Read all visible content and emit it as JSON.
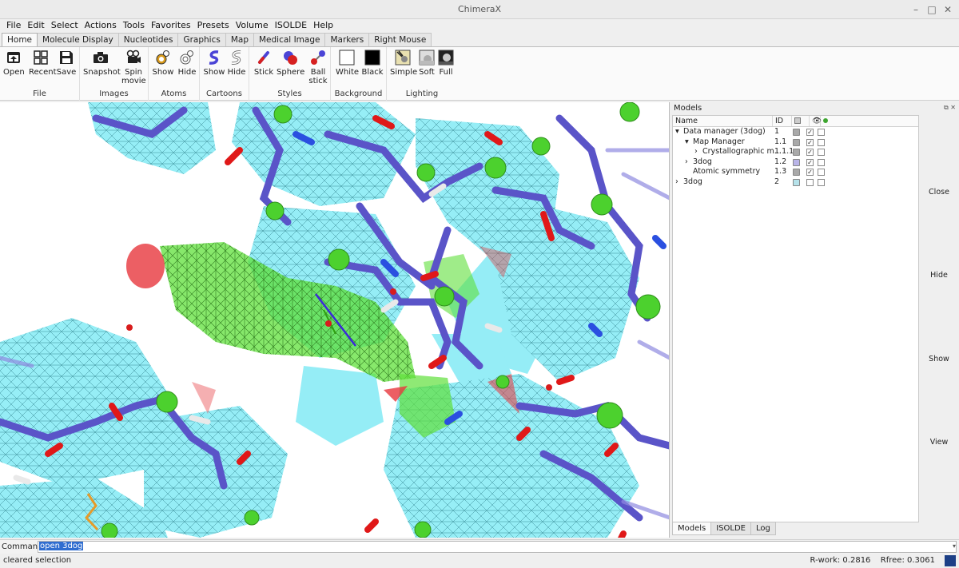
{
  "window": {
    "title": "ChimeraX"
  },
  "menu": [
    "File",
    "Edit",
    "Select",
    "Actions",
    "Tools",
    "Favorites",
    "Presets",
    "Volume",
    "ISOLDE",
    "Help"
  ],
  "ribbon_tabs": [
    "Home",
    "Molecule Display",
    "Nucleotides",
    "Graphics",
    "Map",
    "Medical Image",
    "Markers",
    "Right Mouse"
  ],
  "ribbon": {
    "file": {
      "label": "File",
      "open": "Open",
      "recent": "Recent",
      "save": "Save"
    },
    "images": {
      "label": "Images",
      "snapshot": "Snapshot",
      "spin1": "Spin",
      "spin2": "movie"
    },
    "atoms": {
      "label": "Atoms",
      "show": "Show",
      "hide": "Hide"
    },
    "cartoons": {
      "label": "Cartoons",
      "show": "Show",
      "hide": "Hide"
    },
    "styles": {
      "label": "Styles",
      "stick": "Stick",
      "sphere": "Sphere",
      "ball1": "Ball",
      "ball2": "stick"
    },
    "background": {
      "label": "Background",
      "white": "White",
      "black": "Black"
    },
    "lighting": {
      "label": "Lighting",
      "simple": "Simple",
      "soft": "Soft",
      "full": "Full"
    }
  },
  "models_panel": {
    "title": "Models",
    "headers": {
      "name": "Name",
      "id": "ID"
    },
    "rows": [
      {
        "name": "Data manager (3dog)",
        "id": "1",
        "color": "#a9a9a9",
        "shown": true,
        "indent": 0,
        "arrow": "▾"
      },
      {
        "name": "Map Manager",
        "id": "1.1",
        "color": "#a9a9a9",
        "shown": true,
        "indent": 1,
        "arrow": "▾"
      },
      {
        "name": "Crystallographic m...",
        "id": "1.1.1",
        "color": "#a9a9a9",
        "shown": true,
        "indent": 2,
        "arrow": "›"
      },
      {
        "name": "3dog",
        "id": "1.2",
        "color": "#b9b4e8",
        "shown": true,
        "indent": 1,
        "arrow": "›"
      },
      {
        "name": "Atomic symmetry",
        "id": "1.3",
        "color": "#a9a9a9",
        "shown": true,
        "indent": 1,
        "arrow": ""
      },
      {
        "name": "3dog",
        "id": "2",
        "color": "#b6e2ea",
        "shown": false,
        "indent": 0,
        "arrow": "›"
      }
    ],
    "buttons": {
      "close": "Close",
      "hide": "Hide",
      "show": "Show",
      "view": "View"
    },
    "bottom_tabs": [
      "Models",
      "ISOLDE",
      "Log"
    ]
  },
  "command": {
    "label": "Command:",
    "value": "open 3dog"
  },
  "status": {
    "message": "cleared selection",
    "rwork": "R-work: 0.2816",
    "rfree": "Rfree: 0.3061"
  }
}
